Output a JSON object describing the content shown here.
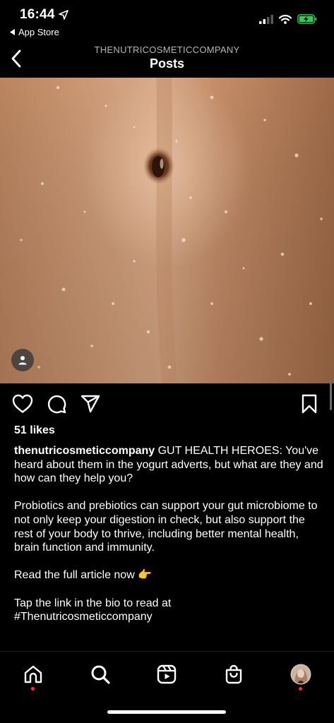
{
  "status_bar": {
    "time": "16:44",
    "back_app": "App Store"
  },
  "header": {
    "account": "THENUTRICOSMETICCOMPANY",
    "title": "Posts"
  },
  "post": {
    "likes": "51 likes",
    "username": "thenutricosmeticcompany",
    "caption_first": " GUT HEALTH HEROES: You've heard about them in the yogurt adverts, but what are they and how can they help you?",
    "paragraph_2": "Probiotics and prebiotics can support your gut microbiome to not only keep your digestion in check, but also support the rest of your body to thrive, including better mental health, brain function and immunity.",
    "paragraph_3": "Read the full article now 👉",
    "paragraph_4_line1": "Tap the link in the bio to read at",
    "paragraph_4_line2": "#Thenutricosmeticcompany"
  },
  "icons": {
    "status": [
      "location-arrow-icon",
      "signal-icon",
      "wifi-icon",
      "battery-charging-icon"
    ],
    "actions": [
      "heart-icon",
      "comment-icon",
      "share-icon",
      "bookmark-icon"
    ],
    "tabs": [
      "home-icon",
      "search-icon",
      "reels-icon",
      "shop-icon",
      "profile-avatar"
    ]
  },
  "colors": {
    "background": "#000000",
    "battery": "#34c759",
    "notification_dot": "#ff2a4e",
    "skin": "#c08c6a"
  }
}
